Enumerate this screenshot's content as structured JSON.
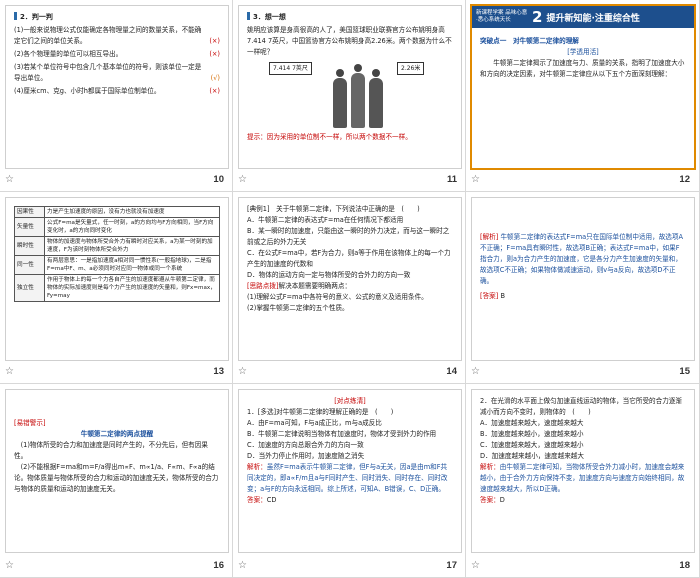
{
  "slides": [
    {
      "number": "10",
      "section": "2．判一判",
      "items": [
        {
          "text": "(1)一般来说物理公式仅能确定各物理量之间的数量关系，不能确定它们之间的单位关系。",
          "mark": "(×)"
        },
        {
          "text": "(2)各个物理量的单位可以相互导出。",
          "mark": "(×)"
        },
        {
          "text": "(3)若某个单位符号中包含几个基本单位的符号，则该单位一定是导出单位。",
          "mark": "(√)"
        },
        {
          "text": "(4)厘米cm、克g、小时h都属于国际单位制单位。",
          "mark": "(×)"
        }
      ]
    },
    {
      "number": "11",
      "section": "3．想一想",
      "body": "姚明应该算是身高很高的人了，美国篮球职业联赛官方公布姚明身高7.414 7英尺，中国篮协官方公布姚明身高2.26米。两个数据为什么不一样呢？",
      "label_left": "7.414 7英尺",
      "label_right": "2.26米",
      "tip_label": "提示：",
      "tip": "因为采用的单位制不一样，所以两个数据不一样。"
    },
    {
      "number": "12",
      "banner_tag": "新课程学案 品味心意·悉心系统天长",
      "banner_num": "2",
      "banner_title": "提升新知能·注重综合性",
      "point": "突破点一　对牛顿第二定律的理解",
      "sub": "[学透用活]",
      "body": "牛顿第二定律揭示了加速度与力、质量的关系，指明了加速度大小和方向的决定因素，对牛顿第二定律应从以下五个方面深刻理解："
    },
    {
      "number": "13",
      "table": [
        {
          "k": "因果性",
          "v": "力是产生加速度的原因，没有力也就没有加速度"
        },
        {
          "k": "矢量性",
          "v": "公式F=ma是矢量式，任一时刻，a的方向均与F方向相同，当F方向变化时，a的方向同时变化"
        },
        {
          "k": "瞬时性",
          "v": "物体的加速度与物体所受合外力有瞬时对应关系，a为某一时刻的加速度，F为该时刻物体所受合外力"
        },
        {
          "k": "同一性",
          "v": "有两层意思：一是指加速度a相对同一惯性系(一般指地球)，二是指F=ma中F、m、a必须同时对应同一物体或同一个系统"
        },
        {
          "k": "独立性",
          "v": "作用于物体上的每一个力各自产生的加速度都遵从牛顿第二定律，而物体的实际加速度则是每个力产生的加速度的矢量和，则Fx=max，Fy=may"
        }
      ]
    },
    {
      "number": "14",
      "head": "[典例1]　关于牛顿第二定律，下列说法中正确的是　(　　)",
      "options": [
        "A．牛顿第二定律的表达式F=ma在任何情况下都适用",
        "B．某一瞬时的加速度，只能由这一瞬时的外力决定，而与这一瞬时之前或之后的外力无关",
        "C．在公式F=ma中，若F为合力，则a等于作用在该物体上的每一个力产生的加速度的代数和",
        "D．物体的运动方向一定与物体所受的合外力的方向一致"
      ],
      "think_label": "[思路点拨]",
      "think_intro": "解决本题需要明确两点：",
      "think": [
        "(1)理解公式F=ma中各符号的意义、公式的意义及适用条件。",
        "(2)掌握牛顿第二定律的五个性质。"
      ]
    },
    {
      "number": "15",
      "jx_label": "[解析]",
      "jx": "牛顿第二定律的表达式F=ma只在国际单位制中适用，故选项A不正确；F=ma具有瞬时性，故选项B正确；表达式F=ma中，如果F指合力，则a为合力产生的加速度，它是各分力产生加速度的矢量和，故选项C不正确；如果物体做减速运动，则v与a反向，故选项D不正确。",
      "ans_label": "[答案]",
      "ans": "B"
    },
    {
      "number": "16",
      "warn": "[易错警示]",
      "title": "牛顿第二定律的两点提醒",
      "p1": "(1)物体所受的合力和加速度是同时产生的，不分先后，但有因果性。",
      "p2": "(2)不能根据F=ma和m=F/a得出m∝F、m∝1/a、F∝m、F∝a的结论。物体质量与物体所受的合力和运动的加速度无关，物体所受的合力与物体的质量和运动的加速度无关。"
    },
    {
      "number": "17",
      "head": "[对点练清]",
      "q": "1．[多选]对牛顿第二定律的理解正确的是　(　　)",
      "options": [
        "A．由F=ma可知，F与a成正比，m与a成反比",
        "B．牛顿第二定律说明当物体有加速度时，物体才受到外力的作用",
        "C．加速度的方向总跟合外力的方向一致",
        "D．当外力停止作用时，加速度随之消失"
      ],
      "jx_label": "解析：",
      "jx": "虽然F=ma表示牛顿第二定律，但F与a无关，因a是由m和F共同决定的，即a∝F/m且a与F同时产生、同时消失、同时存在、同时改变；a与F的方向永远相同。综上所述，可知A、B错误，C、D正确。",
      "ans_label": "答案：",
      "ans": "CD"
    },
    {
      "number": "18",
      "q": "2．在光滑的水平面上做匀加速直线运动的物体，当它所受的合力逐渐减小而方向不变时，则物体的　(　　)",
      "options": [
        "A．加速度越来越大，速度越来越大",
        "B．加速度越来越小，速度越来越小",
        "C．加速度越来越大，速度越来越小",
        "D．加速度越来越小，速度越来越大"
      ],
      "jx_label": "解析：",
      "jx": "由牛顿第二定律可知，当物体所受合外力减小时，加速度会越来越小，由于合外力方向保持不变，加速度方向与速度方向始终相同，故速度越来越大，所以D正确。",
      "ans_label": "答案：",
      "ans": "D"
    }
  ],
  "selected_slide": "12",
  "colors": {
    "accent": "#e08a00",
    "banner": "#1d4f8d",
    "wrong_mark": "#c40000",
    "text_blue": "#1a4f9c"
  },
  "icons": {
    "slide_marker": "star-icon"
  }
}
